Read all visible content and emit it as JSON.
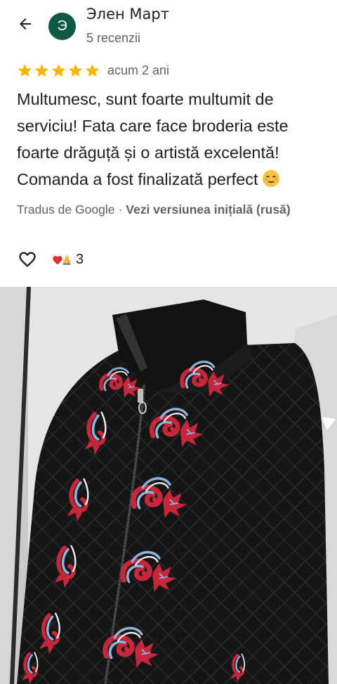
{
  "header": {
    "avatar_letter": "Э",
    "reviewer_name": "Элен Март",
    "review_count": "5 recenzii"
  },
  "review": {
    "rating": 5,
    "rating_max": 5,
    "time_ago": "acum 2 ani",
    "text": "Multumesc, sunt foarte multumit de serviciu! Fata care face broderia este foarte drăguță și o artistă excelentă! Comanda a fost finalizată perfect",
    "translated_by": "Tradus de Google",
    "separator": "·",
    "view_original": "Vezi versiunea inițială (rusă)"
  },
  "reactions": {
    "count": "3"
  },
  "colors": {
    "avatar_bg": "#0f5a44",
    "star": "#f4b400",
    "secondary_text": "#5f6368",
    "jacket": "#151515",
    "embroidery_red": "#c8263a",
    "embroidery_blue": "#8fb3dd"
  },
  "icons": {
    "back": "arrow-left-icon",
    "like": "heart-outline-icon",
    "reaction_1": "red-heart-emoji",
    "reaction_2": "folded-hands-emoji",
    "text_emoji": "smiling-face-emoji"
  }
}
